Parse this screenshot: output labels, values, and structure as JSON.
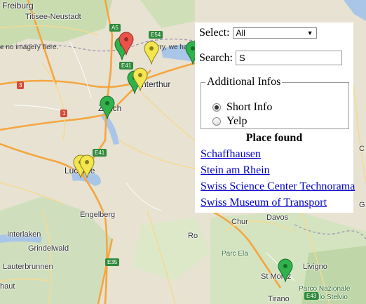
{
  "map": {
    "labels": {
      "freiburg": "Freiburg",
      "titisee": "Titisee-Neustadt",
      "winterthur": "Winterthur",
      "zurich": "Zürich",
      "lucerne": "Lucerne",
      "engelberg": "Engelberg",
      "interlaken": "Interlaken",
      "grindelwald": "Grindelwald",
      "lauterbrunnen": "Lauterbrunnen",
      "chur": "Chur",
      "davos": "Davos",
      "livigno": "Livigno",
      "st_moritz": "St Moritz",
      "parc_ela": "Parc Ela",
      "parco": "Parco Nazionale",
      "dello_stelvio": "dello Stelvio",
      "ro": "Ro",
      "haut": "haut",
      "tirano": "Tirano",
      "ch_fragment": "C",
      "g_fragment": "G"
    },
    "no_imagery_left": "e no imagery here.",
    "no_imagery_right": "Sorry, we have",
    "shields": {
      "a5": "A5",
      "e54": "E54",
      "e41_top": "E41",
      "e41_mid": "E41",
      "r1": "1",
      "r3": "3",
      "e35": "E35",
      "e43": "E43"
    }
  },
  "panel": {
    "select_label": "Select:",
    "select_value": "All",
    "search_label": "Search:",
    "search_value": "S",
    "additional_legend": "Additional Infos",
    "radio_short": "Short Info",
    "radio_yelp": "Yelp",
    "radio_selected": "Short Info",
    "found_title": "Place found",
    "results": [
      "Schaffhausen",
      "Stein am Rhein",
      "Swiss Science Center Technorama",
      "Swiss Museum of Transport"
    ]
  },
  "colors": {
    "marker_green": "#2fb24a",
    "marker_yellow": "#f3e64e",
    "marker_red": "#e9534a",
    "link": "#0000cc"
  }
}
